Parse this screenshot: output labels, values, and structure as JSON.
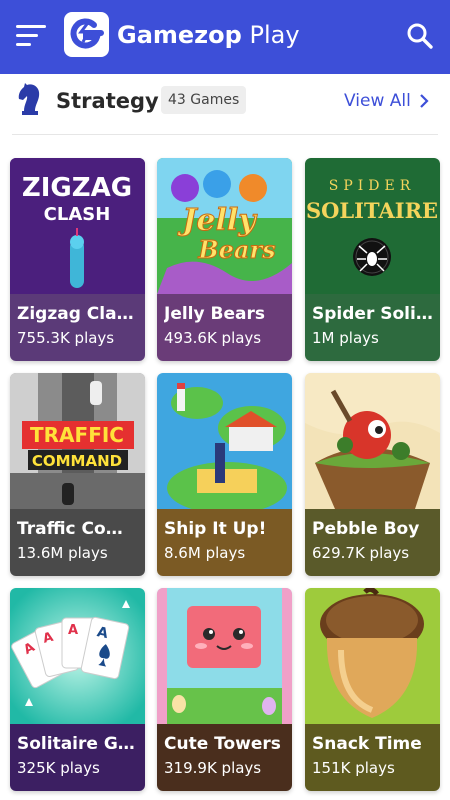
{
  "header": {
    "brand_bold": "Gamezop",
    "brand_light": "Play",
    "bar_color": "#3d4fd8"
  },
  "section": {
    "title": "Strategy",
    "count": "43 Games",
    "view_all": "View All"
  },
  "games": [
    {
      "title": "Zigzag Clash",
      "plays": "755.3K plays",
      "banner_top": "ZIGZAG",
      "banner_bottom": "CLASH",
      "info_color": "#5b3a78"
    },
    {
      "title": "Jelly Bears",
      "plays": "493.6K plays",
      "banner_top": "Jelly",
      "banner_bottom": "Bears",
      "info_color": "#6a3c78"
    },
    {
      "title": "Spider Solitaire",
      "plays": "1M plays",
      "banner_top": "SPIDER",
      "banner_bottom": "SOLITAIRE",
      "info_color": "#2d6a3e"
    },
    {
      "title": "Traffic Command",
      "plays": "13.6M plays",
      "banner_top": "TRAFFIC",
      "banner_bottom": "COMMAND",
      "info_color": "#4a4a4a"
    },
    {
      "title": "Ship It Up!",
      "plays": "8.6M plays",
      "banner_top": "",
      "banner_bottom": "",
      "info_color": "#7b5a24"
    },
    {
      "title": "Pebble Boy",
      "plays": "629.7K plays",
      "banner_top": "",
      "banner_bottom": "",
      "info_color": "#5a5a2a"
    },
    {
      "title": "Solitaire Gold",
      "plays": "325K plays",
      "banner_top": "",
      "banner_bottom": "",
      "info_color": "#3c1f62"
    },
    {
      "title": "Cute Towers",
      "plays": "319.9K plays",
      "banner_top": "",
      "banner_bottom": "",
      "info_color": "#4a2e1d"
    },
    {
      "title": "Snack Time",
      "plays": "151K plays",
      "banner_top": "",
      "banner_bottom": "",
      "info_color": "#5e5a1f"
    }
  ]
}
